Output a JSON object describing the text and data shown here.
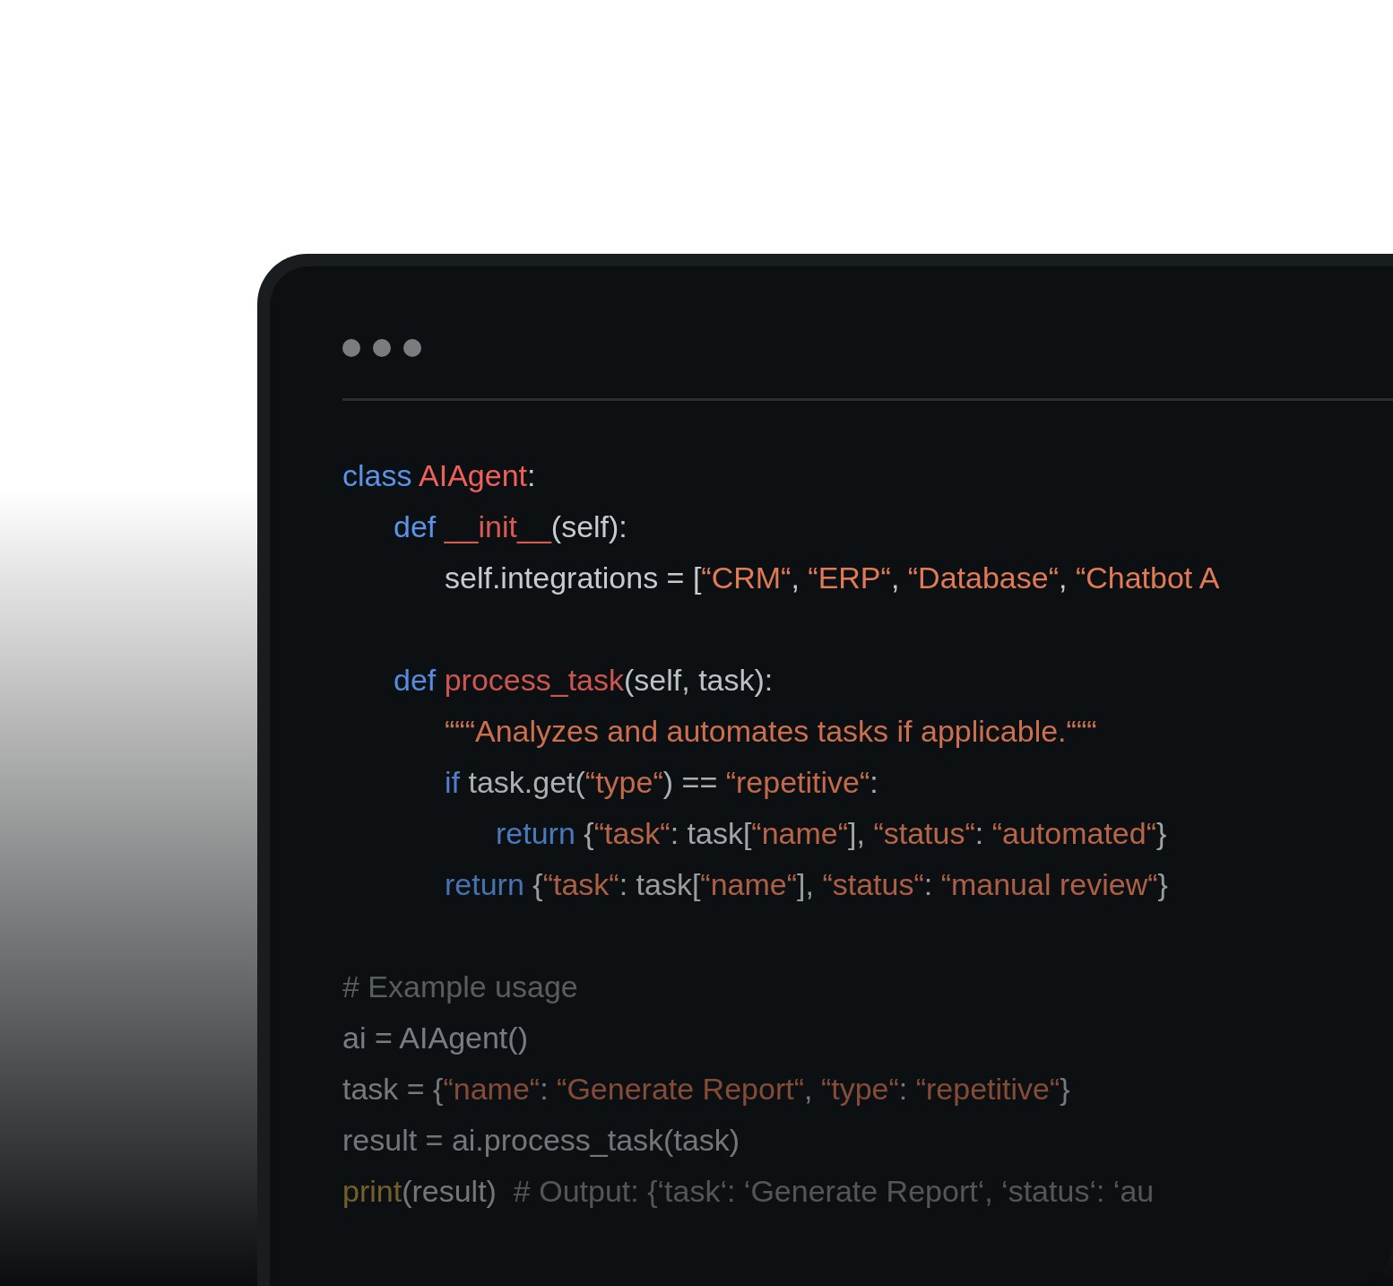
{
  "code": {
    "lines": [
      {
        "tokens": [
          {
            "kind": "keyword",
            "text": "class"
          },
          {
            "kind": "class_name",
            "text": " AIAgent"
          },
          {
            "kind": "plain",
            "text": ":"
          }
        ],
        "children": [
          {
            "tokens": [
              {
                "kind": "keyword",
                "text": "def"
              },
              {
                "kind": "function_name",
                "text": " __init__"
              },
              {
                "kind": "plain",
                "text": "(self):"
              }
            ],
            "children": [
              {
                "tokens": [
                  {
                    "kind": "plain",
                    "text": "self.integrations = ["
                  },
                  {
                    "kind": "string",
                    "text": "“CRM“"
                  },
                  {
                    "kind": "plain",
                    "text": ", "
                  },
                  {
                    "kind": "string",
                    "text": "“ERP“"
                  },
                  {
                    "kind": "plain",
                    "text": ", "
                  },
                  {
                    "kind": "string",
                    "text": "“Database“"
                  },
                  {
                    "kind": "plain",
                    "text": ", "
                  },
                  {
                    "kind": "string",
                    "text": "“Chatbot A"
                  }
                ]
              }
            ]
          },
          {
            "gap_before": true,
            "tokens": [
              {
                "kind": "keyword",
                "text": "def"
              },
              {
                "kind": "function_name",
                "text": " process_task"
              },
              {
                "kind": "plain",
                "text": "(self, task):"
              }
            ],
            "children": [
              {
                "tokens": [
                  {
                    "kind": "string",
                    "text": "“““Analyzes and automates tasks if applicable.“““"
                  }
                ]
              },
              {
                "tokens": [
                  {
                    "kind": "keyword",
                    "text": "if"
                  },
                  {
                    "kind": "plain",
                    "text": " task.get("
                  },
                  {
                    "kind": "string",
                    "text": "“type“"
                  },
                  {
                    "kind": "plain",
                    "text": ") == "
                  },
                  {
                    "kind": "string",
                    "text": "“repetitive“"
                  },
                  {
                    "kind": "plain",
                    "text": ":"
                  }
                ],
                "children": [
                  {
                    "tokens": [
                      {
                        "kind": "keyword",
                        "text": "return"
                      },
                      {
                        "kind": "plain",
                        "text": " {"
                      },
                      {
                        "kind": "string",
                        "text": "“task“"
                      },
                      {
                        "kind": "plain",
                        "text": ": task["
                      },
                      {
                        "kind": "string",
                        "text": "“name“"
                      },
                      {
                        "kind": "plain",
                        "text": "], "
                      },
                      {
                        "kind": "string",
                        "text": "“status“"
                      },
                      {
                        "kind": "plain",
                        "text": ": "
                      },
                      {
                        "kind": "string",
                        "text": "“automated“"
                      },
                      {
                        "kind": "plain",
                        "text": "}"
                      }
                    ]
                  }
                ]
              },
              {
                "tokens": [
                  {
                    "kind": "keyword",
                    "text": "return"
                  },
                  {
                    "kind": "plain",
                    "text": " {"
                  },
                  {
                    "kind": "string",
                    "text": "“task“"
                  },
                  {
                    "kind": "plain",
                    "text": ": task["
                  },
                  {
                    "kind": "string",
                    "text": "“name“"
                  },
                  {
                    "kind": "plain",
                    "text": "], "
                  },
                  {
                    "kind": "string",
                    "text": "“status“"
                  },
                  {
                    "kind": "plain",
                    "text": ": "
                  },
                  {
                    "kind": "string",
                    "text": "“manual review“"
                  },
                  {
                    "kind": "plain",
                    "text": "}"
                  }
                ]
              }
            ]
          }
        ]
      },
      {
        "gap_before": true,
        "tokens": [
          {
            "kind": "comment",
            "text": "# Example usage"
          }
        ]
      },
      {
        "tokens": [
          {
            "kind": "plain",
            "text": "ai = AIAgent()"
          }
        ]
      },
      {
        "tokens": [
          {
            "kind": "plain",
            "text": "task = {"
          },
          {
            "kind": "string",
            "text": "“name“"
          },
          {
            "kind": "plain",
            "text": ": "
          },
          {
            "kind": "string",
            "text": "“Generate Report“"
          },
          {
            "kind": "plain",
            "text": ", "
          },
          {
            "kind": "string",
            "text": "“type“"
          },
          {
            "kind": "plain",
            "text": ": "
          },
          {
            "kind": "string",
            "text": "“repetitive“"
          },
          {
            "kind": "plain",
            "text": "}"
          }
        ]
      },
      {
        "tokens": [
          {
            "kind": "plain",
            "text": "result = ai.process_task(task)"
          }
        ]
      },
      {
        "tokens": [
          {
            "kind": "builtin",
            "text": "print"
          },
          {
            "kind": "plain",
            "text": "(result)  "
          },
          {
            "kind": "comment",
            "text": "# Output: {‘task‘: ‘Generate Report‘, ‘status‘: ‘au"
          }
        ]
      }
    ]
  }
}
